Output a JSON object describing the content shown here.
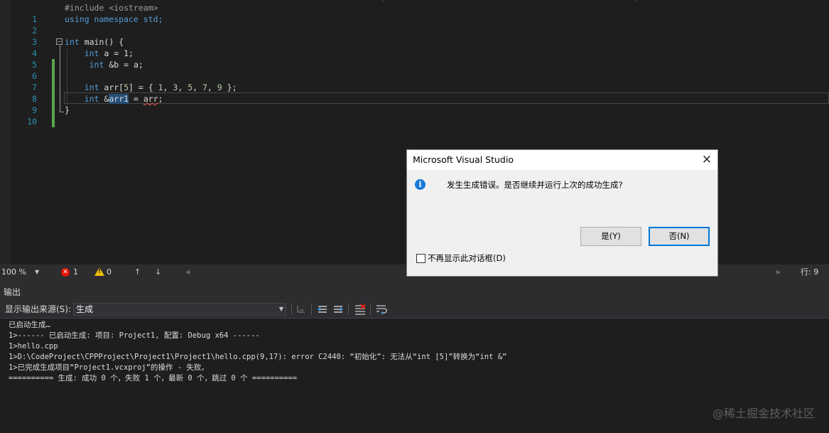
{
  "editor": {
    "lines": [
      {
        "num": "1",
        "text": "#include <iostream>"
      },
      {
        "num": "2",
        "text": "using namespace std;"
      },
      {
        "num": "3",
        "text": ""
      },
      {
        "num": "4",
        "text": "int main() {"
      },
      {
        "num": "5",
        "text": "    int a = 1;"
      },
      {
        "num": "6",
        "text": "     int &b = a;"
      },
      {
        "num": "7",
        "text": ""
      },
      {
        "num": "8",
        "text": "    int arr[5] = { 1, 3, 5, 7, 9 };"
      },
      {
        "num": "9",
        "text": "    int &arr1 = arr;"
      },
      {
        "num": "10",
        "text": "}"
      }
    ],
    "line8": {
      "nums": [
        "1",
        "3",
        "5",
        "7",
        "9"
      ]
    },
    "line9": {
      "selected": "arr1",
      "squiggled": "arr"
    }
  },
  "status": {
    "zoom": "100 %",
    "errors": "1",
    "warnings": "0",
    "line_pos": "行: 9"
  },
  "output": {
    "title": "输出",
    "source_label": "显示输出来源(S):",
    "source_value": "生成",
    "lines": [
      "已启动生成…",
      "1>------ 已启动生成: 项目: Project1, 配置: Debug x64 ------",
      "1>hello.cpp",
      "1>D:\\CodeProject\\CPPProject\\Project1\\Project1\\hello.cpp(9,17): error C2440: “初始化”: 无法从“int [5]”转换为“int &”",
      "1>已完成生成项目“Project1.vcxproj”的操作 - 失败。",
      "========== 生成: 成功 0 个，失败 1 个，最新 0 个，跳过 0 个 =========="
    ]
  },
  "dialog": {
    "title": "Microsoft Visual Studio",
    "close_glyph": "✕",
    "message": "发生生成错误。是否继续并运行上次的成功生成?",
    "yes_label": "是(Y)",
    "no_label": "否(N)",
    "checkbox_label": "不再显示此对话框(D)"
  },
  "watermark": "@稀土掘金技术社区",
  "icons": {
    "error": "error-circle-icon",
    "warning": "warning-triangle-icon",
    "info": "info-circle-icon",
    "up": "arrow-up-icon",
    "down": "arrow-down-icon"
  },
  "colors": {
    "keyword": "#569cd6",
    "number": "#b5cea8",
    "preprocessor": "#9b9b9b",
    "line_number": "#2b91af",
    "change_bar": "#57a64a",
    "selection": "#264f78",
    "accent": "#0078d7"
  }
}
